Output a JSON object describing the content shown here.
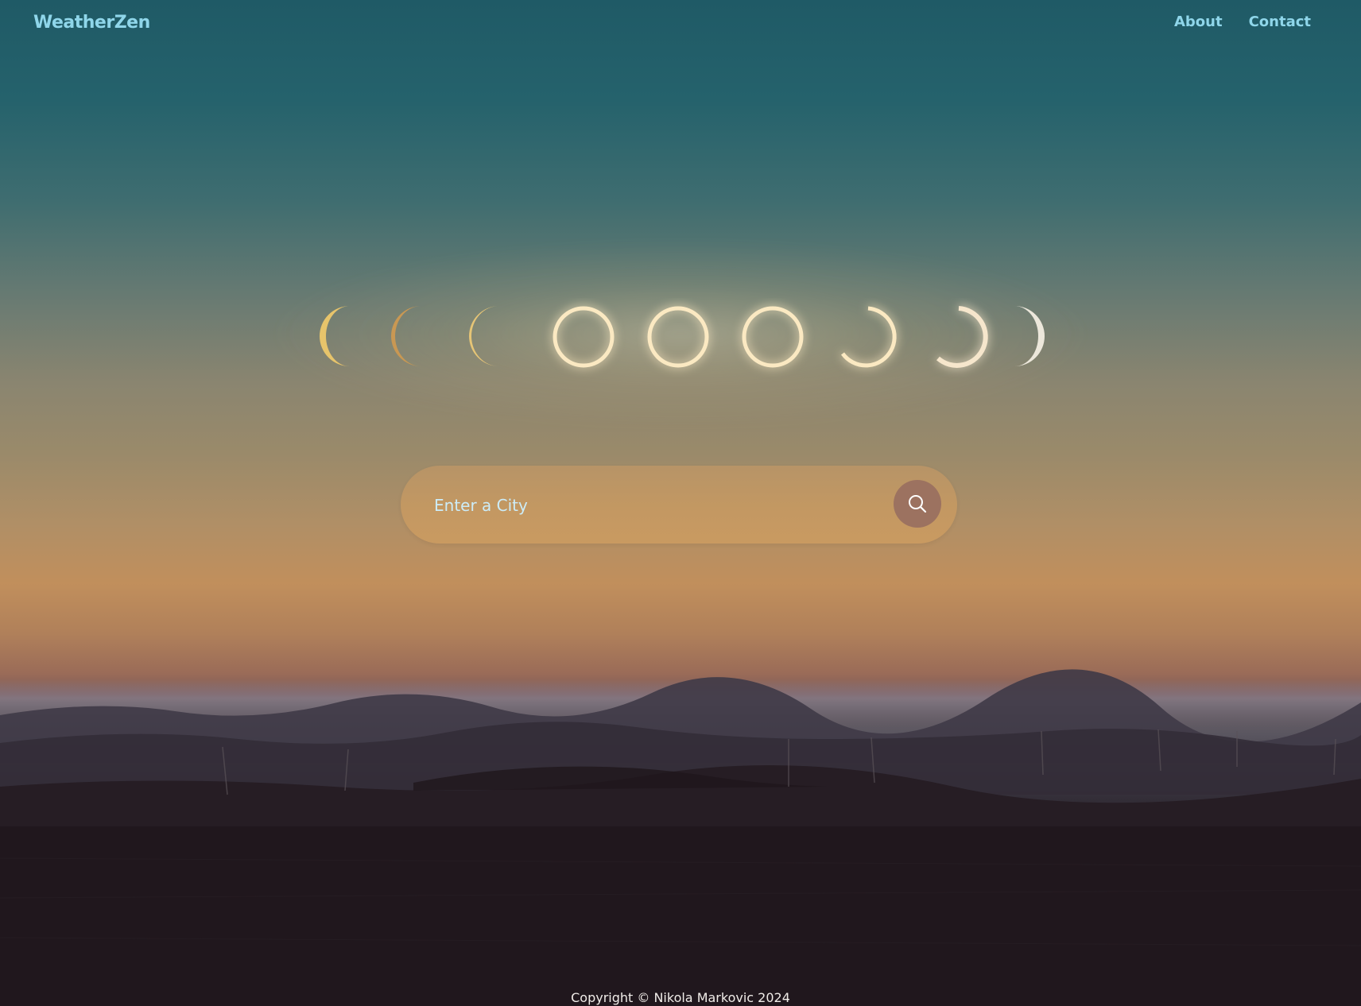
{
  "header": {
    "logo": "WeatherZen",
    "nav": [
      {
        "label": "About"
      },
      {
        "label": "Contact"
      }
    ]
  },
  "search": {
    "placeholder": "Enter a City",
    "button_icon": "search-icon"
  },
  "footer": {
    "copyright": "Copyright © Nikola Markovic 2024"
  },
  "hero": {
    "image": "eclipse-phases-over-desert",
    "colors": {
      "accent": "#8fd6ea",
      "search_bar": "#c39862",
      "search_button": "#9c7260"
    }
  }
}
